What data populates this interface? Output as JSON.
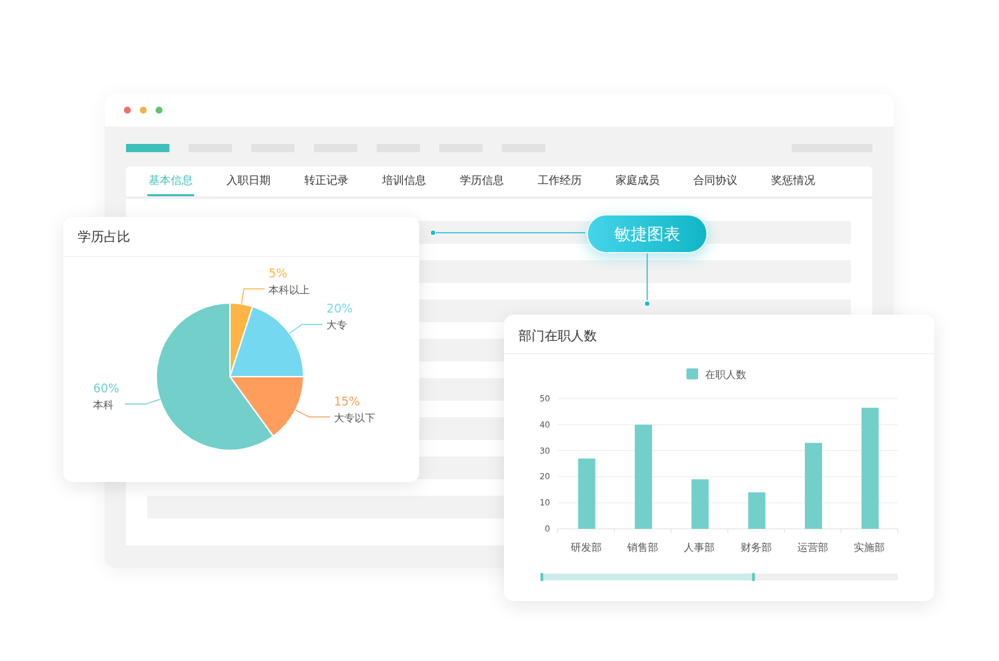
{
  "window": {
    "nav_bars": [
      {
        "selected": true
      },
      {
        "selected": false
      },
      {
        "selected": false
      },
      {
        "selected": false
      },
      {
        "selected": false
      },
      {
        "selected": false
      },
      {
        "selected": false
      }
    ],
    "tabs": [
      {
        "label": "基本信息",
        "selected": true
      },
      {
        "label": "入职日期",
        "selected": false
      },
      {
        "label": "转正记录",
        "selected": false
      },
      {
        "label": "培训信息",
        "selected": false
      },
      {
        "label": "学历信息",
        "selected": false
      },
      {
        "label": "工作经历",
        "selected": false
      },
      {
        "label": "家庭成员",
        "selected": false
      },
      {
        "label": "合同协议",
        "selected": false
      },
      {
        "label": "奖惩情况",
        "selected": false
      }
    ]
  },
  "callout": {
    "label": "敏捷图表"
  },
  "education_card": {
    "title": "学历占比",
    "chart_data": {
      "type": "pie",
      "categories": [
        "本科以上",
        "大专",
        "大专以下",
        "本科"
      ],
      "values": [
        5,
        20,
        15,
        60
      ],
      "colors": [
        "#ffb545",
        "#74d8f0",
        "#ff9d5c",
        "#72cfca"
      ],
      "value_labels": [
        "5%",
        "20%",
        "15%",
        "60%"
      ]
    }
  },
  "department_card": {
    "title": "部门在职人数",
    "chart_data": {
      "type": "bar",
      "categories": [
        "研发部",
        "销售部",
        "人事部",
        "财务部",
        "运营部",
        "实施部"
      ],
      "series": [
        {
          "name": "在职人数",
          "color": "#72cfca",
          "values": [
            27,
            40,
            19,
            14,
            33,
            46.5
          ]
        }
      ],
      "ylim": [
        0,
        50
      ],
      "grid": true,
      "yticks": [
        0,
        10,
        20,
        30,
        40,
        50
      ]
    },
    "zoom_slider": {
      "level": 0.6
    }
  }
}
